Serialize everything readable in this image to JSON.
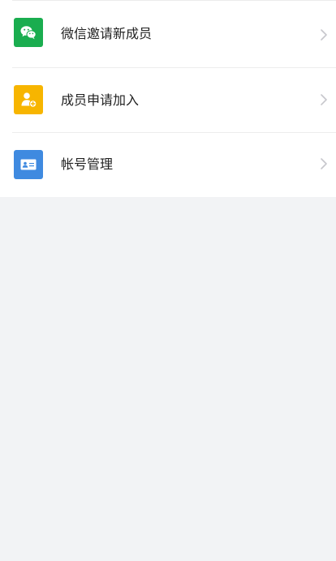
{
  "list": {
    "items": [
      {
        "label": "微信邀请新成员",
        "icon": "wechat-icon",
        "color": "#1aad4f"
      },
      {
        "label": "成员申请加入",
        "icon": "add-member-icon",
        "color": "#f7b500"
      },
      {
        "label": "帐号管理",
        "icon": "id-card-icon",
        "color": "#3f8ae0"
      }
    ],
    "chevron_icon": "chevron-right-icon"
  },
  "colors": {
    "page_background": "#f2f3f5",
    "list_background": "#ffffff",
    "divider": "#ececec",
    "text": "#222222",
    "chevron": "#c7c7cc"
  }
}
